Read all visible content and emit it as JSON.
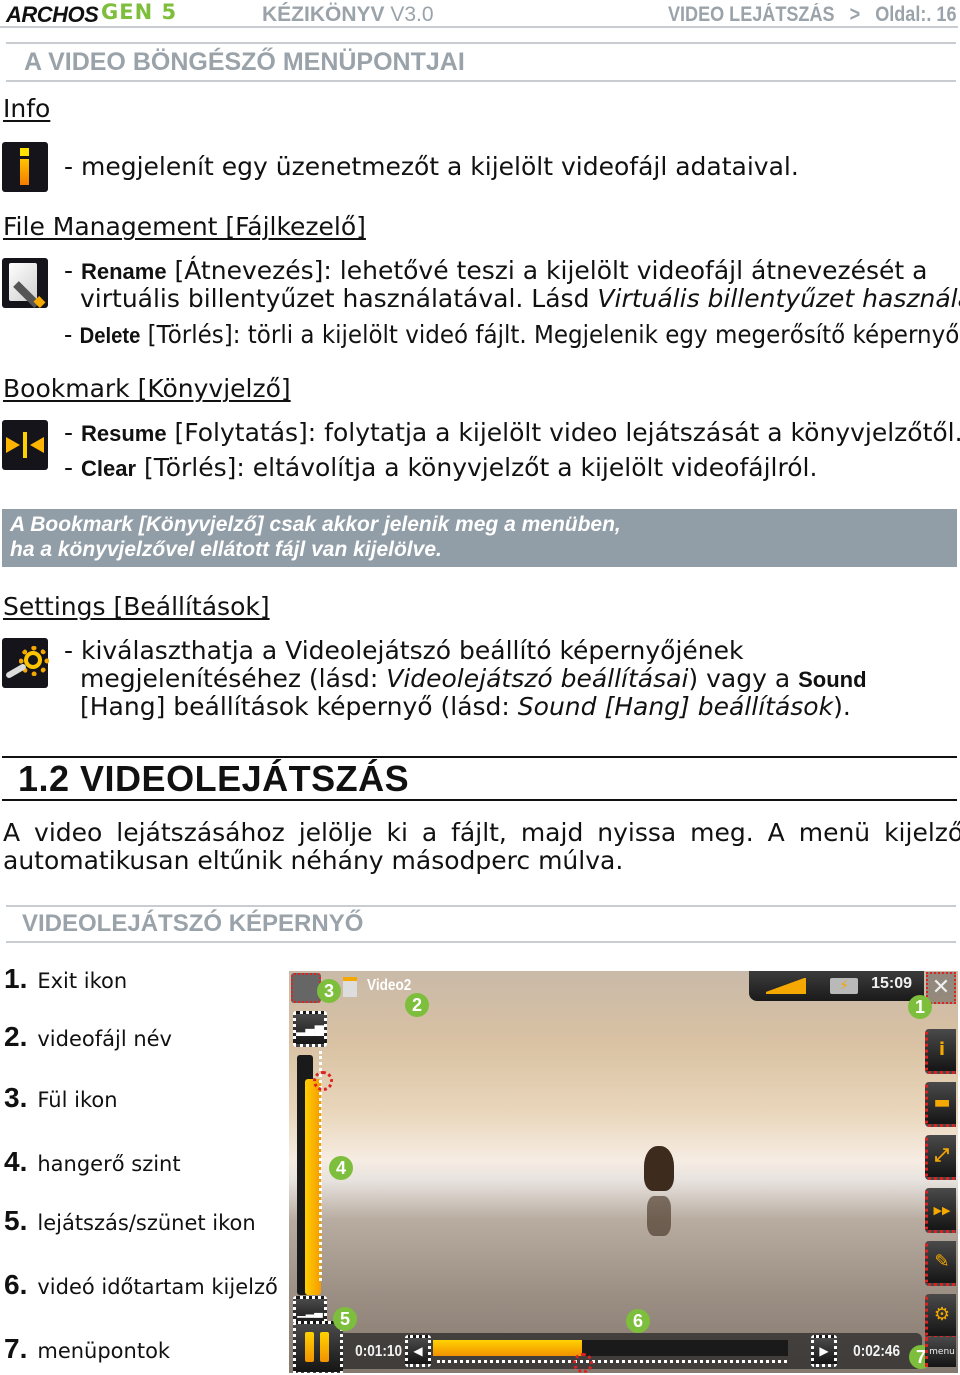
{
  "header": {
    "brand": "ARCHOS",
    "model": "GEN 5",
    "manual": "KÉZIKÖNYV",
    "version": "V3.0",
    "breadcrumb": "VIDEO LEJÁTSZÁS   >   Oldal:. 16"
  },
  "section_title": "A VIDEO BÖNGÉSZŐ MENÜPONTJAI",
  "info": {
    "heading": "Info",
    "icon": "info-icon",
    "text": "- megjelenít egy üzenetmezőt a kijelölt videofájl adataival."
  },
  "file_management": {
    "heading": "File Management [Fájlkezelő]",
    "icon": "rename-pencil-icon",
    "rename_label": "Rename",
    "rename_line1": " [Átnevezés]: lehetővé teszi a kijelölt videofájl átnevezését a",
    "rename_line2_a": "virtuális billentyűzet használatával. Lásd ",
    "rename_line2_em": "Virtuális billentyűzet használata",
    "rename_line2_b": ".",
    "delete_label": "Delete",
    "delete_text": " [Törlés]: törli a kijelölt videó fájlt. Megjelenik egy megerősítő képernyő."
  },
  "bookmark": {
    "heading": "Bookmark [Könyvjelző]",
    "icon": "bookmark-icon",
    "resume_label": "Resume",
    "resume_text": " [Folytatás]: folytatja a kijelölt video lejátszását a könyvjelzőtől.",
    "clear_label": "Clear",
    "clear_text": " [Törlés]: eltávolítja a könyvjelzőt a kijelölt videofájlról."
  },
  "note": {
    "line1": "A Bookmark [Könyvjelző] csak akkor jelenik meg a menüben,",
    "line2": "ha a könyvjelzővel ellátott fájl van kijelölve."
  },
  "settings": {
    "heading": "Settings [Beállítások]",
    "icon": "settings-gear-icon",
    "line1": "- kiválaszthatja a Videolejátszó beállító képernyőjének",
    "line2_a": "megjelenítéséhez (lásd: ",
    "line2_em": "Videolejátszó beállításai",
    "line2_b": ") vagy a ",
    "line2_bold": "Sound",
    "line3_a": "[Hang] beállítások képernyő (lásd: ",
    "line3_em": "Sound [Hang] beállítások",
    "line3_b": ")."
  },
  "chapter": {
    "title": "1.2 VIDEOLEJÁTSZÁS",
    "para_line1": "A video lejátszásához jelölje ki a fájlt, majd nyissa meg. A menü kijelző",
    "para_line2": "automatikusan eltűnik néhány másodperc múlva."
  },
  "screen_section": {
    "title": "VIDEOLEJÁTSZÓ KÉPERNYŐ",
    "legend": [
      {
        "num": "1.",
        "label": "Exit ikon"
      },
      {
        "num": "2.",
        "label": "videofájl név"
      },
      {
        "num": "3.",
        "label": "Fül ikon"
      },
      {
        "num": "4.",
        "label": "hangerő szint"
      },
      {
        "num": "5.",
        "label": "lejátszás/szünet ikon"
      },
      {
        "num": "6.",
        "label": "videó időtartam kijelző"
      },
      {
        "num": "7.",
        "label": "menüpontok"
      }
    ]
  },
  "player": {
    "video_name": "Video2",
    "clock": "15:09",
    "elapsed": "0:01:10",
    "duration": "0:02:46",
    "progress_fraction": 0.42,
    "volume_fraction": 0.9,
    "menu_label": "menu",
    "badges": [
      "1",
      "2",
      "3",
      "4",
      "5",
      "6",
      "7"
    ],
    "side_menu_icons": [
      "info-icon",
      "display-settings-icon",
      "fullscreen-icon",
      "speed-icon",
      "bookmark-pen-icon",
      "settings-gear-icon"
    ],
    "accent": "#f5a800",
    "badge_color": "#7dbe3c"
  }
}
